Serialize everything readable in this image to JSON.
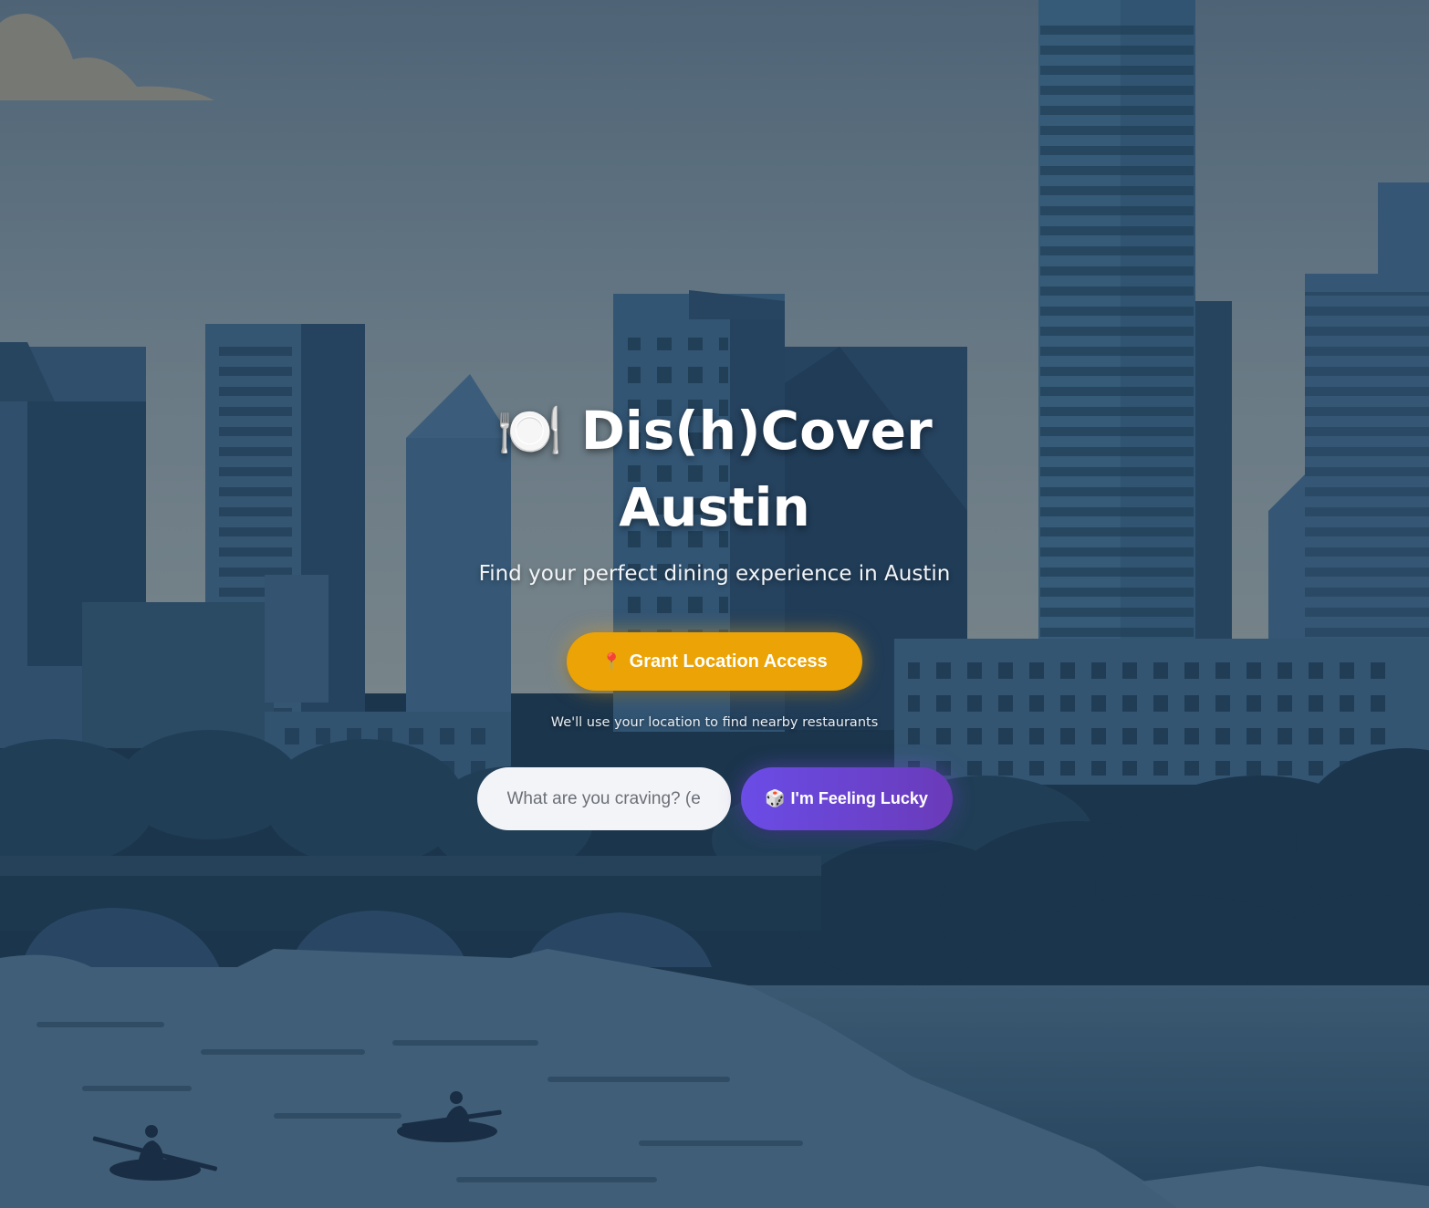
{
  "hero": {
    "title_icon": "🍽️",
    "title_line1": "Dis(h)Cover",
    "title_line2": "Austin",
    "subtitle": "Find your perfect dining experience in Austin"
  },
  "location": {
    "button_icon": "📍",
    "button_label": "Grant Location Access",
    "helper_text": "We'll use your location to find nearby restaurants"
  },
  "search": {
    "placeholder": "What are you craving? (e",
    "value": ""
  },
  "lucky": {
    "button_icon": "🎲",
    "button_label": "I'm Feeling Lucky"
  },
  "colors": {
    "grant_button": "#eba305",
    "lucky_button_start": "#6a4ce6",
    "lucky_button_end": "#6a3bb9",
    "sky": "#6f8596",
    "buildings": "#2f5270",
    "water": "#3a5a76"
  }
}
